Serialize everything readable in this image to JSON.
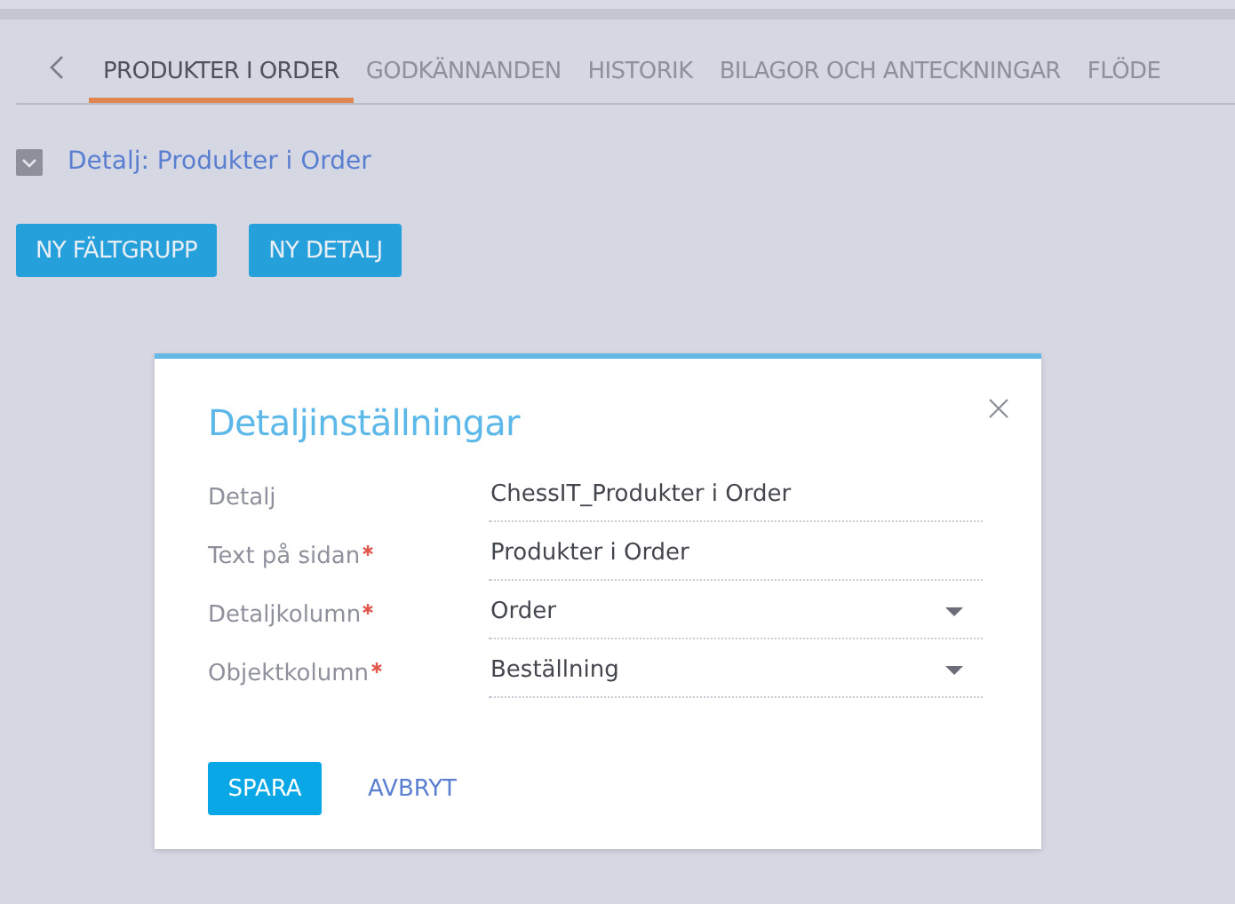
{
  "tabs": [
    {
      "label": "PRODUKTER I ORDER",
      "selected": true
    },
    {
      "label": "GODKÄNNANDEN",
      "selected": false
    },
    {
      "label": "HISTORIK",
      "selected": false
    },
    {
      "label": "BILAGOR OCH ANTECKNINGAR",
      "selected": false
    },
    {
      "label": "FLÖDE",
      "selected": false
    }
  ],
  "detail_group": {
    "title": "Detalj: Produkter i Order",
    "expanded": true
  },
  "buttons": [
    "NY FÄLTGRUPP",
    "NY DETALJ"
  ],
  "dialog": {
    "title": "Detaljinställningar",
    "fields": [
      {
        "label": "Detalj",
        "value": "ChessIT_Produkter i Order",
        "required": false,
        "kind": "text"
      },
      {
        "label": "Text på sidan",
        "value": "Produkter i Order",
        "required": true,
        "kind": "text"
      },
      {
        "label": "Detaljkolumn",
        "value": "Order",
        "required": true,
        "kind": "lookup"
      },
      {
        "label": "Objektkolumn",
        "value": "Beställning",
        "required": true,
        "kind": "lookup"
      }
    ],
    "save": "SPARA",
    "cancel": "AVBRYT"
  }
}
